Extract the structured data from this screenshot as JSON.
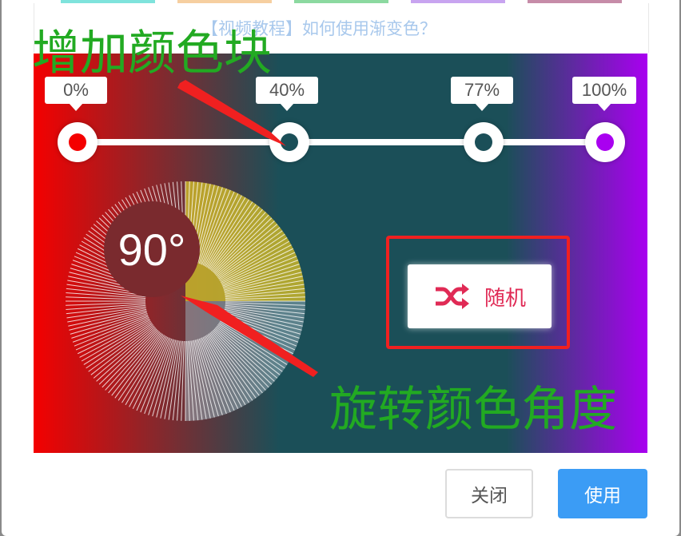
{
  "tutorial_link": "【视频教程】如何使用渐变色？",
  "swatches": [
    "#7fe3dc",
    "#f6cfa0",
    "#f0a0a8",
    "#8cd9a0",
    "#c8a4f0",
    "#c68ca8"
  ],
  "gradient": {
    "stops": [
      {
        "label": "0%",
        "color": "#f40000"
      },
      {
        "label": "40%",
        "color": "#1b4f58"
      },
      {
        "label": "77%",
        "color": "#1b4f58"
      },
      {
        "label": "100%",
        "color": "#a900f0"
      }
    ]
  },
  "angle": {
    "readout": "90°"
  },
  "random_button": {
    "label": "随机",
    "icon": "shuffle-icon",
    "color": "#e02a55"
  },
  "annotations": {
    "add_color_block": "增加颜色块",
    "rotate_angle": "旋转颜色角度",
    "color": "#22aa22",
    "arrow_color": "#f02020"
  },
  "footer": {
    "close_label": "关闭",
    "use_label": "使用",
    "use_color": "#3b9cf5"
  }
}
